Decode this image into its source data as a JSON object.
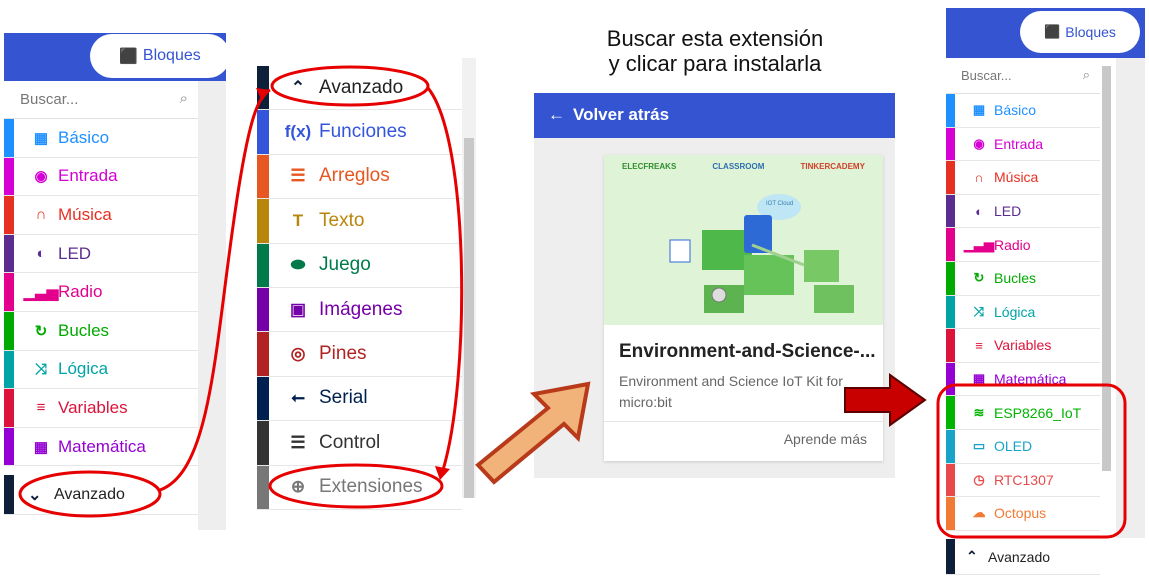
{
  "left_panel": {
    "bloques_label": "Bloques",
    "search_placeholder": "Buscar...",
    "items": [
      {
        "label": "Básico",
        "color": "#1e90ff",
        "icon": "grid-icon",
        "glyph": "▦"
      },
      {
        "label": "Entrada",
        "color": "#d400d4",
        "icon": "target-icon",
        "glyph": "◉"
      },
      {
        "label": "Música",
        "color": "#e63022",
        "icon": "headphones-icon",
        "glyph": "∩"
      },
      {
        "label": "LED",
        "color": "#5c2d91",
        "icon": "toggle-icon",
        "glyph": "◐"
      },
      {
        "label": "Radio",
        "color": "#e3008c",
        "icon": "signal-icon",
        "glyph": "▁▃▅"
      },
      {
        "label": "Bucles",
        "color": "#00aa00",
        "icon": "loop-icon",
        "glyph": "↻"
      },
      {
        "label": "Lógica",
        "color": "#00a4a6",
        "icon": "shuffle-icon",
        "glyph": "⤨"
      },
      {
        "label": "Variables",
        "color": "#dc143c",
        "icon": "list-icon",
        "glyph": "≡"
      },
      {
        "label": "Matemática",
        "color": "#9400d3",
        "icon": "calculator-icon",
        "glyph": "▦"
      }
    ],
    "avanzado_label": "Avanzado"
  },
  "middle_panel": {
    "items": [
      {
        "label": "Avanzado",
        "color": "#0e1f3a",
        "textcolor": "#222",
        "icon": "chevron-up-icon",
        "glyph": "⌃"
      },
      {
        "label": "Funciones",
        "color": "#3455db",
        "textcolor": "#3455db",
        "icon": "function-icon",
        "glyph": "f(x)"
      },
      {
        "label": "Arreglos",
        "color": "#e65722",
        "textcolor": "#e65722",
        "icon": "ordered-list-icon",
        "glyph": "☰"
      },
      {
        "label": "Texto",
        "color": "#b8860b",
        "textcolor": "#b8860b",
        "icon": "text-icon",
        "glyph": "T"
      },
      {
        "label": "Juego",
        "color": "#007a4b",
        "textcolor": "#007a4b",
        "icon": "gamepad-icon",
        "glyph": "⬬"
      },
      {
        "label": "Imágenes",
        "color": "#7600a8",
        "textcolor": "#7600a8",
        "icon": "image-icon",
        "glyph": "▣"
      },
      {
        "label": "Pines",
        "color": "#b22222",
        "textcolor": "#b22222",
        "icon": "pin-icon",
        "glyph": "◎"
      },
      {
        "label": "Serial",
        "color": "#002050",
        "textcolor": "#002050",
        "icon": "usb-icon",
        "glyph": "⭠"
      },
      {
        "label": "Control",
        "color": "#333333",
        "textcolor": "#333333",
        "icon": "server-icon",
        "glyph": "☰"
      },
      {
        "label": "Extensiones",
        "color": "#777777",
        "textcolor": "#777777",
        "icon": "plus-circle-icon",
        "glyph": "⊕"
      }
    ]
  },
  "instruction": {
    "line1": "Buscar esta extensión",
    "line2": "y clicar para instalarla"
  },
  "extension_panel": {
    "back_label": "Volver atrás",
    "card_title": "Environment-and-Science-...",
    "card_desc": "Environment and Science IoT Kit for micro:bit",
    "learn_more": "Aprende más",
    "brands": [
      "ELECFREAKS",
      "CLASSROOM",
      "TINKERCADEMY"
    ],
    "cloud_label": "IOT Cloud",
    "header_color": "#3454d1"
  },
  "right_panel": {
    "bloques_label": "Bloques",
    "search_placeholder": "Buscar...",
    "items": [
      {
        "label": "Básico",
        "color": "#1e90ff",
        "icon": "grid-icon",
        "glyph": "▦"
      },
      {
        "label": "Entrada",
        "color": "#d400d4",
        "icon": "target-icon",
        "glyph": "◉"
      },
      {
        "label": "Música",
        "color": "#e63022",
        "icon": "headphones-icon",
        "glyph": "∩"
      },
      {
        "label": "LED",
        "color": "#5c2d91",
        "icon": "toggle-icon",
        "glyph": "◐"
      },
      {
        "label": "Radio",
        "color": "#e3008c",
        "icon": "signal-icon",
        "glyph": "▁▃▅"
      },
      {
        "label": "Bucles",
        "color": "#00aa00",
        "icon": "loop-icon",
        "glyph": "↻"
      },
      {
        "label": "Lógica",
        "color": "#00a4a6",
        "icon": "shuffle-icon",
        "glyph": "⤨"
      },
      {
        "label": "Variables",
        "color": "#dc143c",
        "icon": "list-icon",
        "glyph": "≡"
      },
      {
        "label": "Matemática",
        "color": "#9400d3",
        "icon": "calculator-icon",
        "glyph": "▦"
      },
      {
        "label": "ESP8266_IoT",
        "color": "#00b400",
        "icon": "wifi-icon",
        "glyph": "≋"
      },
      {
        "label": "OLED",
        "color": "#1aa3c8",
        "icon": "monitor-icon",
        "glyph": "▭"
      },
      {
        "label": "RTC1307",
        "color": "#e84a4a",
        "icon": "clock-icon",
        "glyph": "◷"
      },
      {
        "label": "Octopus",
        "color": "#f07a36",
        "icon": "cloud-upload-icon",
        "glyph": "☁"
      }
    ],
    "avanzado_label": "Avanzado"
  },
  "annotation_color": "#e60000"
}
